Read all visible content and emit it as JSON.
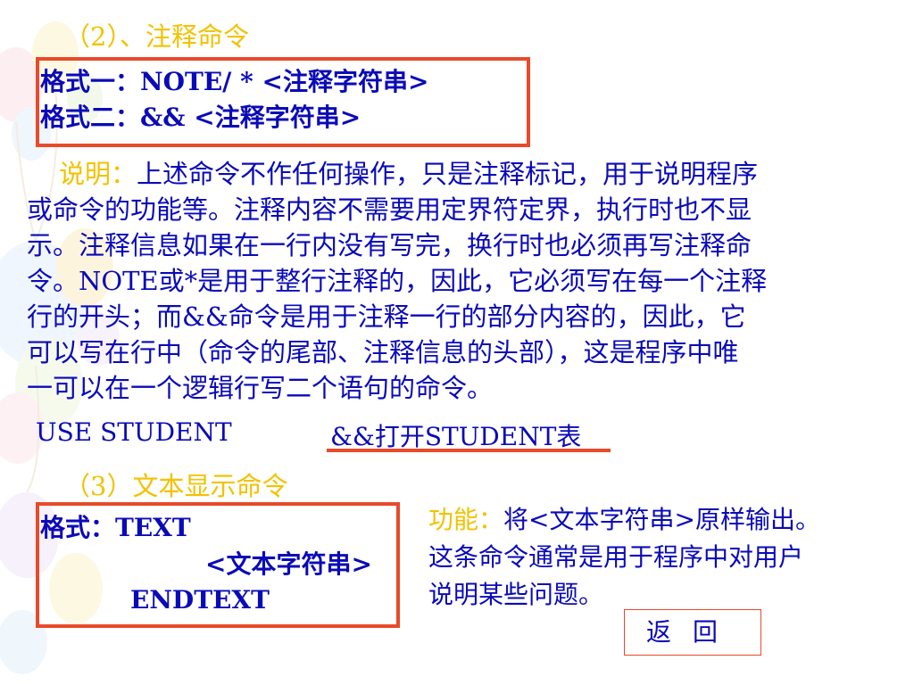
{
  "colors": {
    "heading": "#f2c200",
    "text": "#0a0ab8",
    "box_border": "#e84a2a"
  },
  "section2": {
    "title": "（2）、注释命令",
    "format1": "格式一：NOTE/ * <注释字符串>",
    "format2": "格式二：&& <注释字符串>"
  },
  "description": {
    "label": "说明：",
    "lines": [
      "上述命令不作任何操作，只是注释标记，用于说明程序",
      "或命令的功能等。注释内容不需要用定界符定界，执行时也不显",
      "示。注释信息如果在一行内没有写完，换行时也必须再写注释命",
      "令。NOTE或*是用于整行注释的，因此，它必须写在每一个注释",
      "行的开头；而&&命令是用于注释一行的部分内容的，因此，它",
      "可以写在行中（命令的尾部、注释信息的头部），这是程序中唯",
      "一可以在一个逻辑行写二个语句的命令。"
    ]
  },
  "example": {
    "command": "USE STUDENT",
    "comment": "&&打开STUDENT表"
  },
  "section3": {
    "title": "（3）文本显示命令",
    "format_label": "格式：TEXT",
    "format_body": "<文本字符串>",
    "format_end": "ENDTEXT"
  },
  "function": {
    "label": "功能：",
    "lines": [
      "将<文本字符串>原样输出。",
      "这条命令通常是用于程序中对用户",
      "说明某些问题。"
    ]
  },
  "back_button": "返回"
}
